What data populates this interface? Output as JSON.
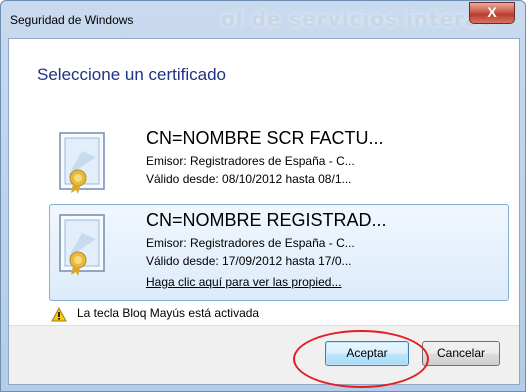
{
  "window": {
    "title": "Seguridad de Windows",
    "close_label": "X",
    "background_text": "ol de servicios interac"
  },
  "dialog": {
    "heading": "Seleccione un certificado",
    "certificates": [
      {
        "name": "CN=NOMBRE SCR FACTU...",
        "issuer": "Emisor: Registradores de España - C...",
        "validity": "Válido desde: 08/10/2012 hasta 08/1...",
        "selected": false
      },
      {
        "name": "CN=NOMBRE REGISTRAD...",
        "issuer": "Emisor: Registradores de España - C...",
        "validity": "Válido desde: 17/09/2012 hasta 17/0...",
        "properties_link": "Haga clic aquí para ver las propied...",
        "selected": true
      }
    ],
    "caps_warning": "La tecla Bloq Mayús está activada",
    "caps_icon": "warning-icon"
  },
  "footer": {
    "accept_label": "Aceptar",
    "cancel_label": "Cancelar"
  },
  "colors": {
    "heading": "#1e3287",
    "selection": "#dcebfb",
    "annotation": "#e21f1f"
  }
}
